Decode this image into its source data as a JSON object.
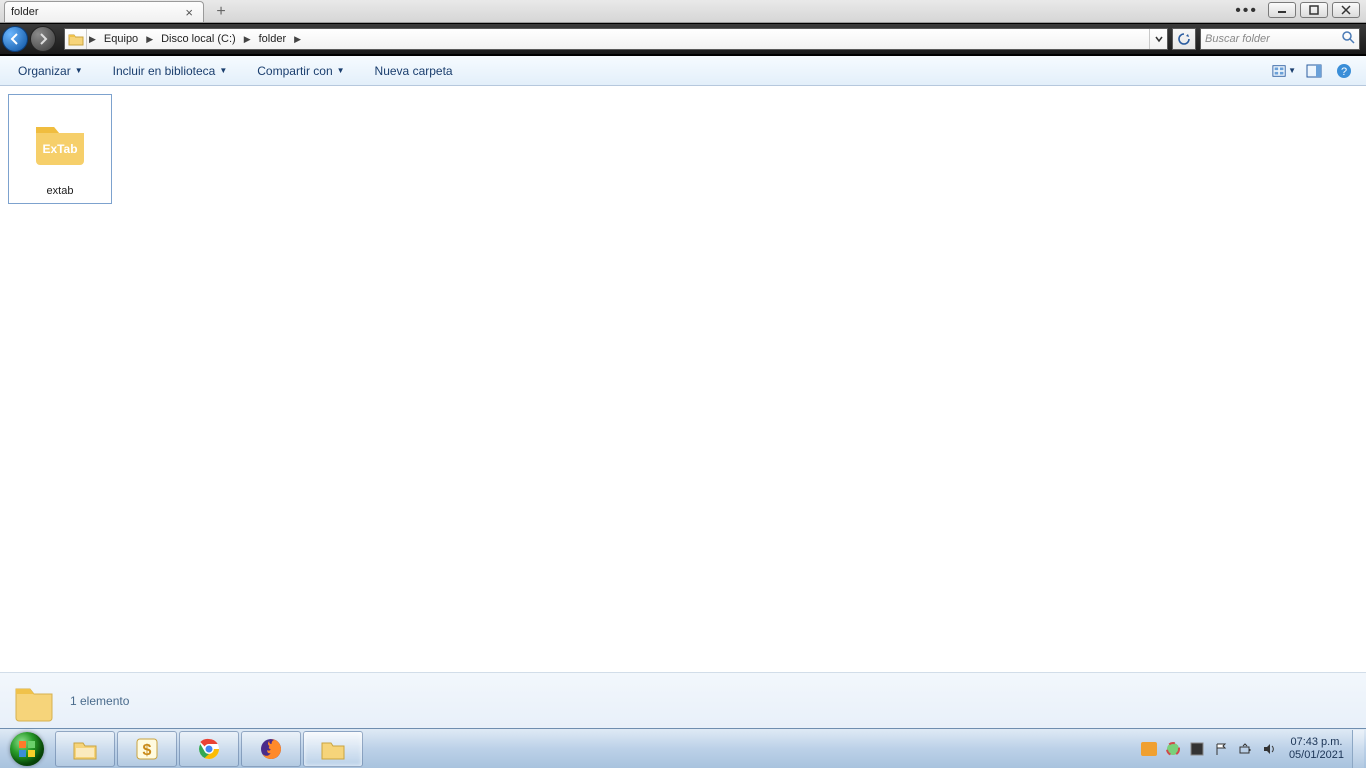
{
  "tab": {
    "title": "folder"
  },
  "breadcrumb": {
    "items": [
      "Equipo",
      "Disco local (C:)",
      "folder"
    ]
  },
  "search": {
    "placeholder": "Buscar folder"
  },
  "toolbar": {
    "organize": "Organizar",
    "include": "Incluir en biblioteca",
    "share": "Compartir con",
    "newfolder": "Nueva carpeta"
  },
  "files": [
    {
      "name": "extab",
      "icon_label": "ExTab"
    }
  ],
  "details": {
    "summary": "1 elemento"
  },
  "clock": {
    "time": "07:43 p.m.",
    "date": "05/01/2021"
  }
}
